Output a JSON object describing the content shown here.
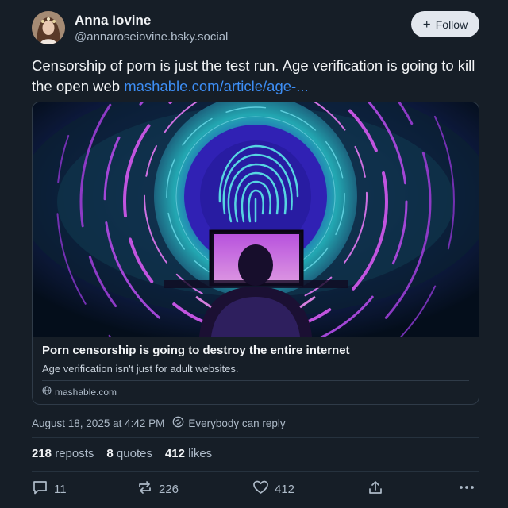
{
  "author": {
    "display_name": "Anna Iovine",
    "handle": "@annaroseiovine.bsky.social"
  },
  "follow_button": {
    "label": "Follow",
    "icon": "plus-icon"
  },
  "post": {
    "text": "Censorship of porn is just the test run. Age verification is going to kill the open web ",
    "link_text": "mashable.com/article/age-..."
  },
  "embed": {
    "title": "Porn censorship is going to destroy the entire internet",
    "description": "Age verification isn't just for adult websites.",
    "domain": "mashable.com"
  },
  "meta": {
    "timestamp": "August 18, 2025 at 4:42 PM",
    "reply_permission": "Everybody can reply"
  },
  "stats": {
    "reposts_count": "218",
    "reposts_label": "reposts",
    "quotes_count": "8",
    "quotes_label": "quotes",
    "likes_count": "412",
    "likes_label": "likes"
  },
  "actions": {
    "replies": "11",
    "reposts": "226",
    "likes": "412"
  },
  "colors": {
    "background": "#161e27",
    "link": "#3d8ef5",
    "muted_text": "#aebbc9",
    "follow_bg": "#e2e7ee"
  }
}
